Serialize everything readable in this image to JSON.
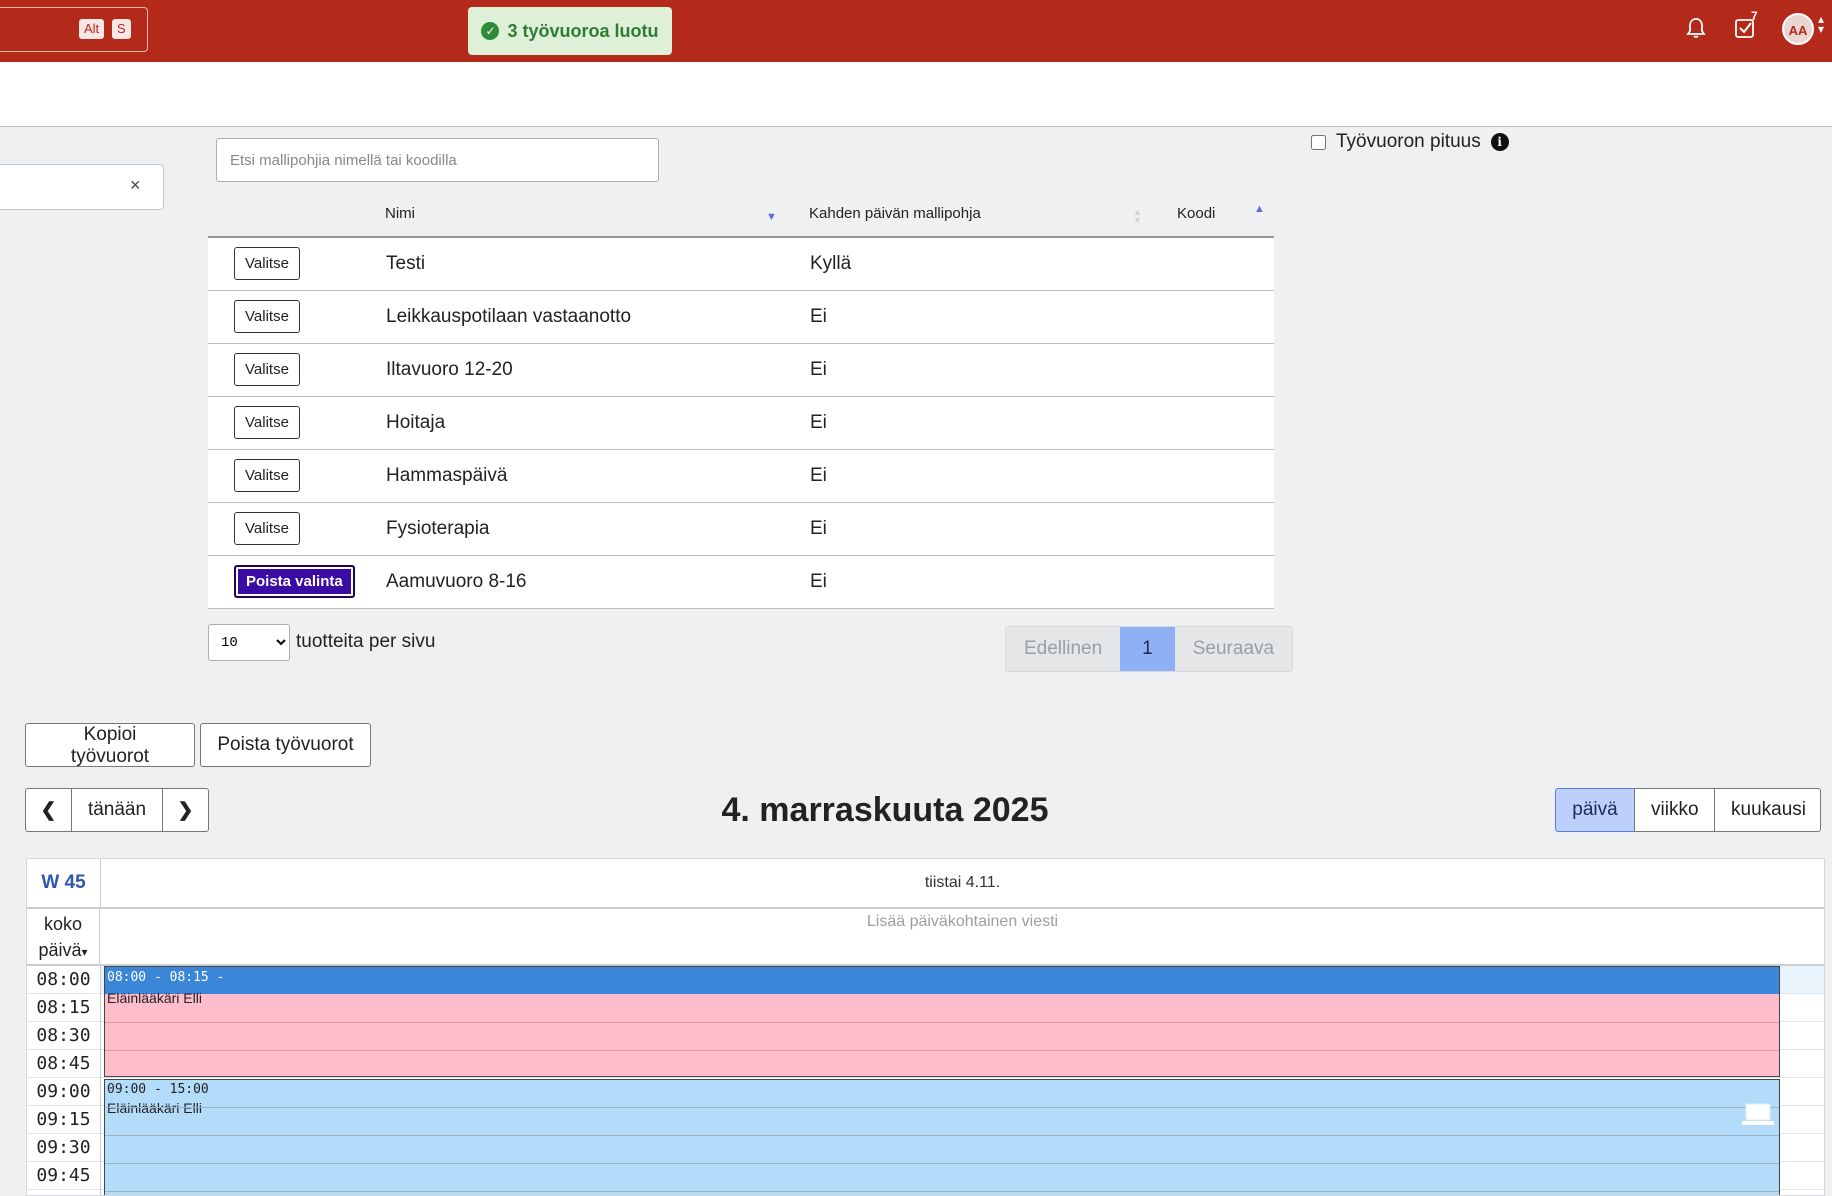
{
  "topbar": {
    "shortcut_keys": [
      "Alt",
      "S"
    ],
    "toast": "3 työvuoroa luotu",
    "tasks_badge": "7",
    "avatar_initials": "AA",
    "brand_color": "#b3291a"
  },
  "template_search": {
    "placeholder": "Etsi mallipohjia nimellä tai koodilla"
  },
  "shift_length": {
    "label": "Työvuoron pituus"
  },
  "table": {
    "columns": [
      "Nimi",
      "Kahden päivän mallipohja",
      "Koodi"
    ],
    "rows": [
      {
        "action": "Valitse",
        "name": "Testi",
        "two_day": "Kyllä",
        "code": ""
      },
      {
        "action": "Valitse",
        "name": "Leikkauspotilaan vastaanotto",
        "two_day": "Ei",
        "code": ""
      },
      {
        "action": "Valitse",
        "name": "Iltavuoro 12-20",
        "two_day": "Ei",
        "code": ""
      },
      {
        "action": "Valitse",
        "name": "Hoitaja",
        "two_day": "Ei",
        "code": ""
      },
      {
        "action": "Valitse",
        "name": "Hammaspäivä",
        "two_day": "Ei",
        "code": ""
      },
      {
        "action": "Valitse",
        "name": "Fysioterapia",
        "two_day": "Ei",
        "code": ""
      },
      {
        "action": "Poista valinta",
        "name": "Aamuvuoro 8-16",
        "two_day": "Ei",
        "code": ""
      }
    ]
  },
  "pagination": {
    "page_size": "10",
    "page_size_label": "tuotteita per sivu",
    "prev": "Edellinen",
    "current": "1",
    "next": "Seuraava"
  },
  "actions": {
    "copy": "Kopioi työvuorot",
    "delete": "Poista työvuorot"
  },
  "calendar": {
    "today": "tänään",
    "title": "4. marraskuuta 2025",
    "views": [
      "päivä",
      "viikko",
      "kuukausi"
    ],
    "active_view": "päivä",
    "week": "W 45",
    "day_header": "tiistai 4.11.",
    "allday_label_1": "koko",
    "allday_label_2": "päivä",
    "allday_message": "Lisää päiväkohtainen viesti",
    "times": [
      "08:00",
      "08:15",
      "08:30",
      "08:45",
      "09:00",
      "09:15",
      "09:30",
      "09:45"
    ],
    "events": [
      {
        "time": "08:00 - 08:15 -",
        "name": "Eläinlääkäri Elli",
        "color": "#ffbccb",
        "header_color": "#3c86d9"
      },
      {
        "time": "09:00 - 15:00",
        "name": "Eläinlääkäri Elli",
        "color": "#b3dcfb"
      }
    ]
  }
}
